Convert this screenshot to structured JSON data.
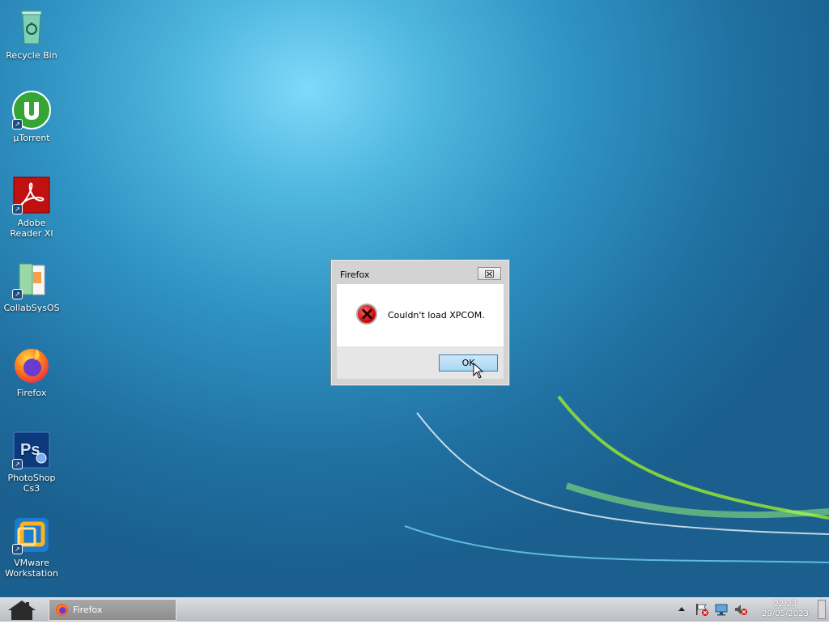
{
  "desktop_icons": [
    {
      "label": "Recycle Bin",
      "icon": "recycle-bin-icon"
    },
    {
      "label": "µTorrent",
      "icon": "utorrent-icon"
    },
    {
      "label": "Adobe Reader XI",
      "icon": "adobe-reader-icon"
    },
    {
      "label": "CollabSysOS",
      "icon": "collabsysos-icon"
    },
    {
      "label": "Firefox",
      "icon": "firefox-icon"
    },
    {
      "label": "PhotoShop Cs3",
      "icon": "photoshop-icon"
    },
    {
      "label": "VMware Workstation",
      "icon": "vmware-icon"
    }
  ],
  "dialog": {
    "title": "Firefox",
    "message": "Couldn't load XPCOM.",
    "ok_label": "OK",
    "icon": "error-icon"
  },
  "taskbar": {
    "start_icon": "home-icon",
    "task_label": "Firefox",
    "tray_icons": [
      "chevron-up-icon",
      "action-center-flag-icon",
      "network-icon",
      "volume-muted-icon"
    ],
    "time": "22:23",
    "date": "29/05/2023"
  },
  "colors": {
    "desktop_light": "#7fd9fa",
    "desktop_dark": "#1a5f8e",
    "button_accent": "#a9d6f1",
    "taskbar": "#c4c7cc"
  }
}
